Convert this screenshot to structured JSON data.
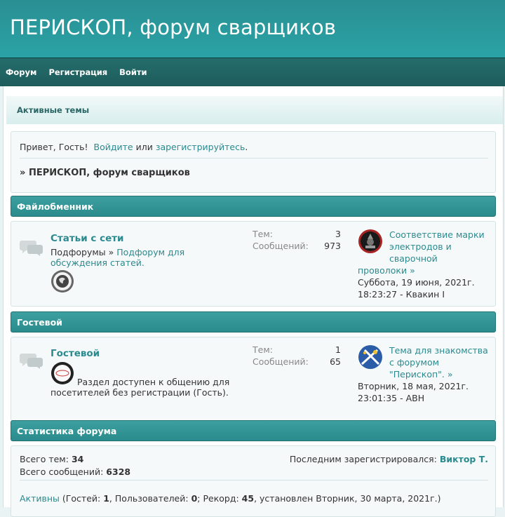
{
  "header": {
    "title": "ПЕРИСКОП, форум сварщиков"
  },
  "nav": {
    "items": [
      "Форум",
      "Регистрация",
      "Войти"
    ]
  },
  "subnav": {
    "label": "Активные темы"
  },
  "welcome": {
    "greeting": "Привет, Гость!",
    "login_link": "Войдите",
    "or": "или",
    "register_link": "зарегистрируйтесь",
    "period": ".",
    "breadcrumb_arrow": "»",
    "breadcrumb": "ПЕРИСКОП, форум сварщиков"
  },
  "sections": [
    {
      "header": "Файлобменник",
      "forum": {
        "name": "Статьи с сети",
        "subforums_label": "Подфорумы »",
        "subforum_link": "Подфорум для обсуждения статей.",
        "description": "",
        "topics_label": "Тем:",
        "topics": "3",
        "posts_label": "Сообщений:",
        "posts": "973",
        "last_topic": "Соответствие марки электродов и сварочной проволоки",
        "last_date": "Суббота, 19 июня, 2021г. 18:23:27",
        "last_author": "Квакин I"
      }
    },
    {
      "header": "Гостевой",
      "forum": {
        "name": "Гостевой",
        "subforums_label": "",
        "subforum_link": "",
        "description": "Раздел доступен к общению для посетителей без регистрации (Гость).",
        "topics_label": "Тем:",
        "topics": "1",
        "posts_label": "Сообщений:",
        "posts": "65",
        "last_topic": "Тема для знакомства с форумом \"Перископ\".",
        "last_date": "Вторник, 18 мая, 2021г. 23:01:35",
        "last_author": "АВН"
      }
    }
  ],
  "stats": {
    "header": "Статистика форума",
    "total_topics_label": "Всего тем:",
    "total_topics": "34",
    "total_posts_label": "Всего сообщений:",
    "total_posts": "6328",
    "last_registered_label": "Последним зарегистрировался:",
    "last_registered": "Виктор Т.",
    "active_link": "Активны",
    "active_text_1": "(Гостей:",
    "guests": "1",
    "active_text_2": ", Пользователей:",
    "users": "0",
    "active_text_3": "; Рекорд:",
    "record": "45",
    "active_text_4": ", установлен Вторник, 30 марта, 2021г.)"
  },
  "colors": {
    "accent": "#2a8a8f",
    "header_bg": "#2a9a9d",
    "nav_bg": "#1f6463"
  },
  "icons": {
    "forum": "speech-bubbles-icon",
    "arrow": "double-chevron-right-icon"
  }
}
